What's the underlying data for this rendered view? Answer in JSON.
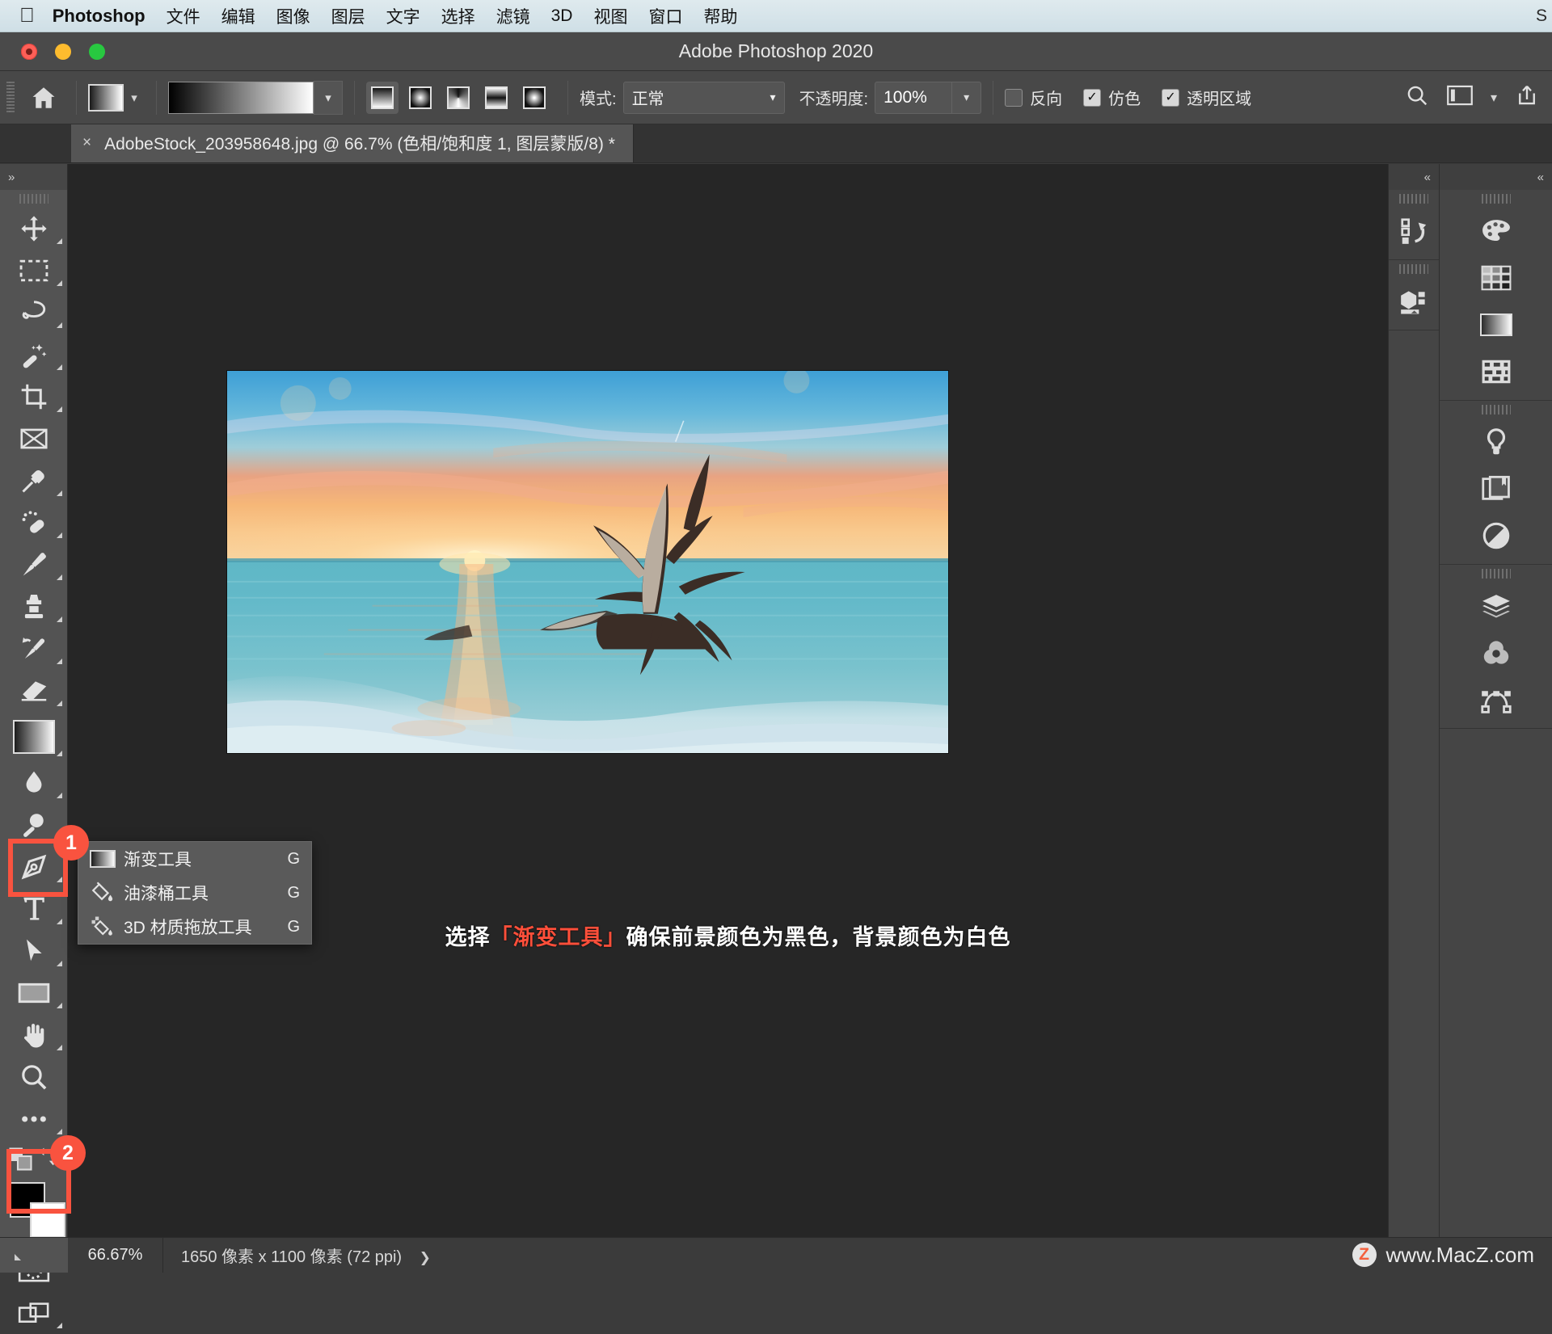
{
  "macbar": {
    "apple_icon": "apple-icon",
    "app_name": "Photoshop",
    "menus": [
      "文件",
      "编辑",
      "图像",
      "图层",
      "文字",
      "选择",
      "滤镜",
      "3D",
      "视图",
      "窗口",
      "帮助"
    ],
    "right_fragment": "S"
  },
  "window": {
    "title": "Adobe Photoshop 2020",
    "traffic_lights": [
      "close",
      "minimize",
      "zoom"
    ]
  },
  "options_bar": {
    "home_icon": "home-icon",
    "gradient_swatch_label": "gradient-preset-swatch",
    "gradient_preview_label": "gradient-preview",
    "gradient_types": [
      {
        "name": "linear-gradient-button",
        "selected": true
      },
      {
        "name": "radial-gradient-button",
        "selected": false
      },
      {
        "name": "angle-gradient-button",
        "selected": false
      },
      {
        "name": "reflected-gradient-button",
        "selected": false
      },
      {
        "name": "diamond-gradient-button",
        "selected": false
      }
    ],
    "mode_label": "模式:",
    "mode_value": "正常",
    "opacity_label": "不透明度:",
    "opacity_value": "100%",
    "checkboxes": [
      {
        "label": "反向",
        "checked": false
      },
      {
        "label": "仿色",
        "checked": true
      },
      {
        "label": "透明区域",
        "checked": true
      }
    ],
    "right_icons": [
      "search-icon",
      "workspace-icon",
      "chevron-down-icon",
      "share-icon"
    ]
  },
  "document_tab": {
    "close_glyph": "×",
    "title": "AdobeStock_203958648.jpg @ 66.7% (色相/饱和度 1, 图层蒙版/8) *"
  },
  "toolbar": {
    "collapse_glyph": "»",
    "tools": [
      {
        "name": "move-tool",
        "has_submenu": true
      },
      {
        "name": "rectangular-marquee-tool",
        "has_submenu": true
      },
      {
        "name": "lasso-tool",
        "has_submenu": true
      },
      {
        "name": "magic-wand-tool",
        "has_submenu": true
      },
      {
        "name": "crop-tool",
        "has_submenu": true
      },
      {
        "name": "frame-tool",
        "has_submenu": false
      },
      {
        "name": "eyedropper-tool",
        "has_submenu": true
      },
      {
        "name": "spot-healing-brush-tool",
        "has_submenu": true
      },
      {
        "name": "brush-tool",
        "has_submenu": true
      },
      {
        "name": "clone-stamp-tool",
        "has_submenu": true
      },
      {
        "name": "history-brush-tool",
        "has_submenu": true
      },
      {
        "name": "eraser-tool",
        "has_submenu": true
      },
      {
        "name": "gradient-tool",
        "has_submenu": true,
        "selected": true
      },
      {
        "name": "blur-tool",
        "has_submenu": true
      },
      {
        "name": "dodge-tool",
        "has_submenu": true
      },
      {
        "name": "pen-tool",
        "has_submenu": true
      },
      {
        "name": "horizontal-type-tool",
        "has_submenu": true
      },
      {
        "name": "path-selection-tool",
        "has_submenu": true
      },
      {
        "name": "rectangle-tool",
        "has_submenu": true
      },
      {
        "name": "hand-tool",
        "has_submenu": true
      },
      {
        "name": "zoom-tool",
        "has_submenu": false
      },
      {
        "name": "edit-toolbar-more",
        "has_submenu": true
      }
    ],
    "default_colors_icon": "default-colors-icon",
    "swap_colors_icon": "swap-colors-icon",
    "foreground_color": "#000000",
    "background_color": "#ffffff",
    "quick_mask_icon": "quick-mask-icon",
    "screen_mode_icon": "screen-mode-icon"
  },
  "flyout_menu": {
    "items": [
      {
        "label": "渐变工具",
        "shortcut": "G",
        "icon": "gradient-icon"
      },
      {
        "label": "油漆桶工具",
        "shortcut": "G",
        "icon": "paint-bucket-icon"
      },
      {
        "label": "3D 材质拖放工具",
        "shortcut": "G",
        "icon": "3d-material-drop-icon"
      }
    ]
  },
  "annotations": {
    "badge_one": "1",
    "badge_two": "2",
    "accent_color": "#f9533f"
  },
  "caption": {
    "part1": "选择",
    "part2": "「渐变工具」",
    "part3": "确保前景颜色为黑色，背景颜色为白色"
  },
  "right_dock": {
    "collapse_left_glyph": "«",
    "collapse_right_glyph": "«",
    "left_column_icons": [
      "history-panel-icon",
      "3d-panel-icon"
    ],
    "right_column_groups": [
      [
        "color-panel-icon",
        "swatches-panel-icon",
        "gradients-panel-icon",
        "patterns-panel-icon"
      ],
      [
        "adjustments-panel-icon",
        "libraries-panel-icon",
        "properties-panel-icon"
      ],
      [
        "layers-panel-icon",
        "channels-panel-icon",
        "paths-panel-icon"
      ]
    ]
  },
  "status_bar": {
    "zoom": "66.67%",
    "dimensions": "1650 像素 x 1100 像素 (72 ppi)",
    "arrow_glyph": "❯",
    "watermark_badge": "Z",
    "watermark_text": "www.MacZ.com"
  }
}
